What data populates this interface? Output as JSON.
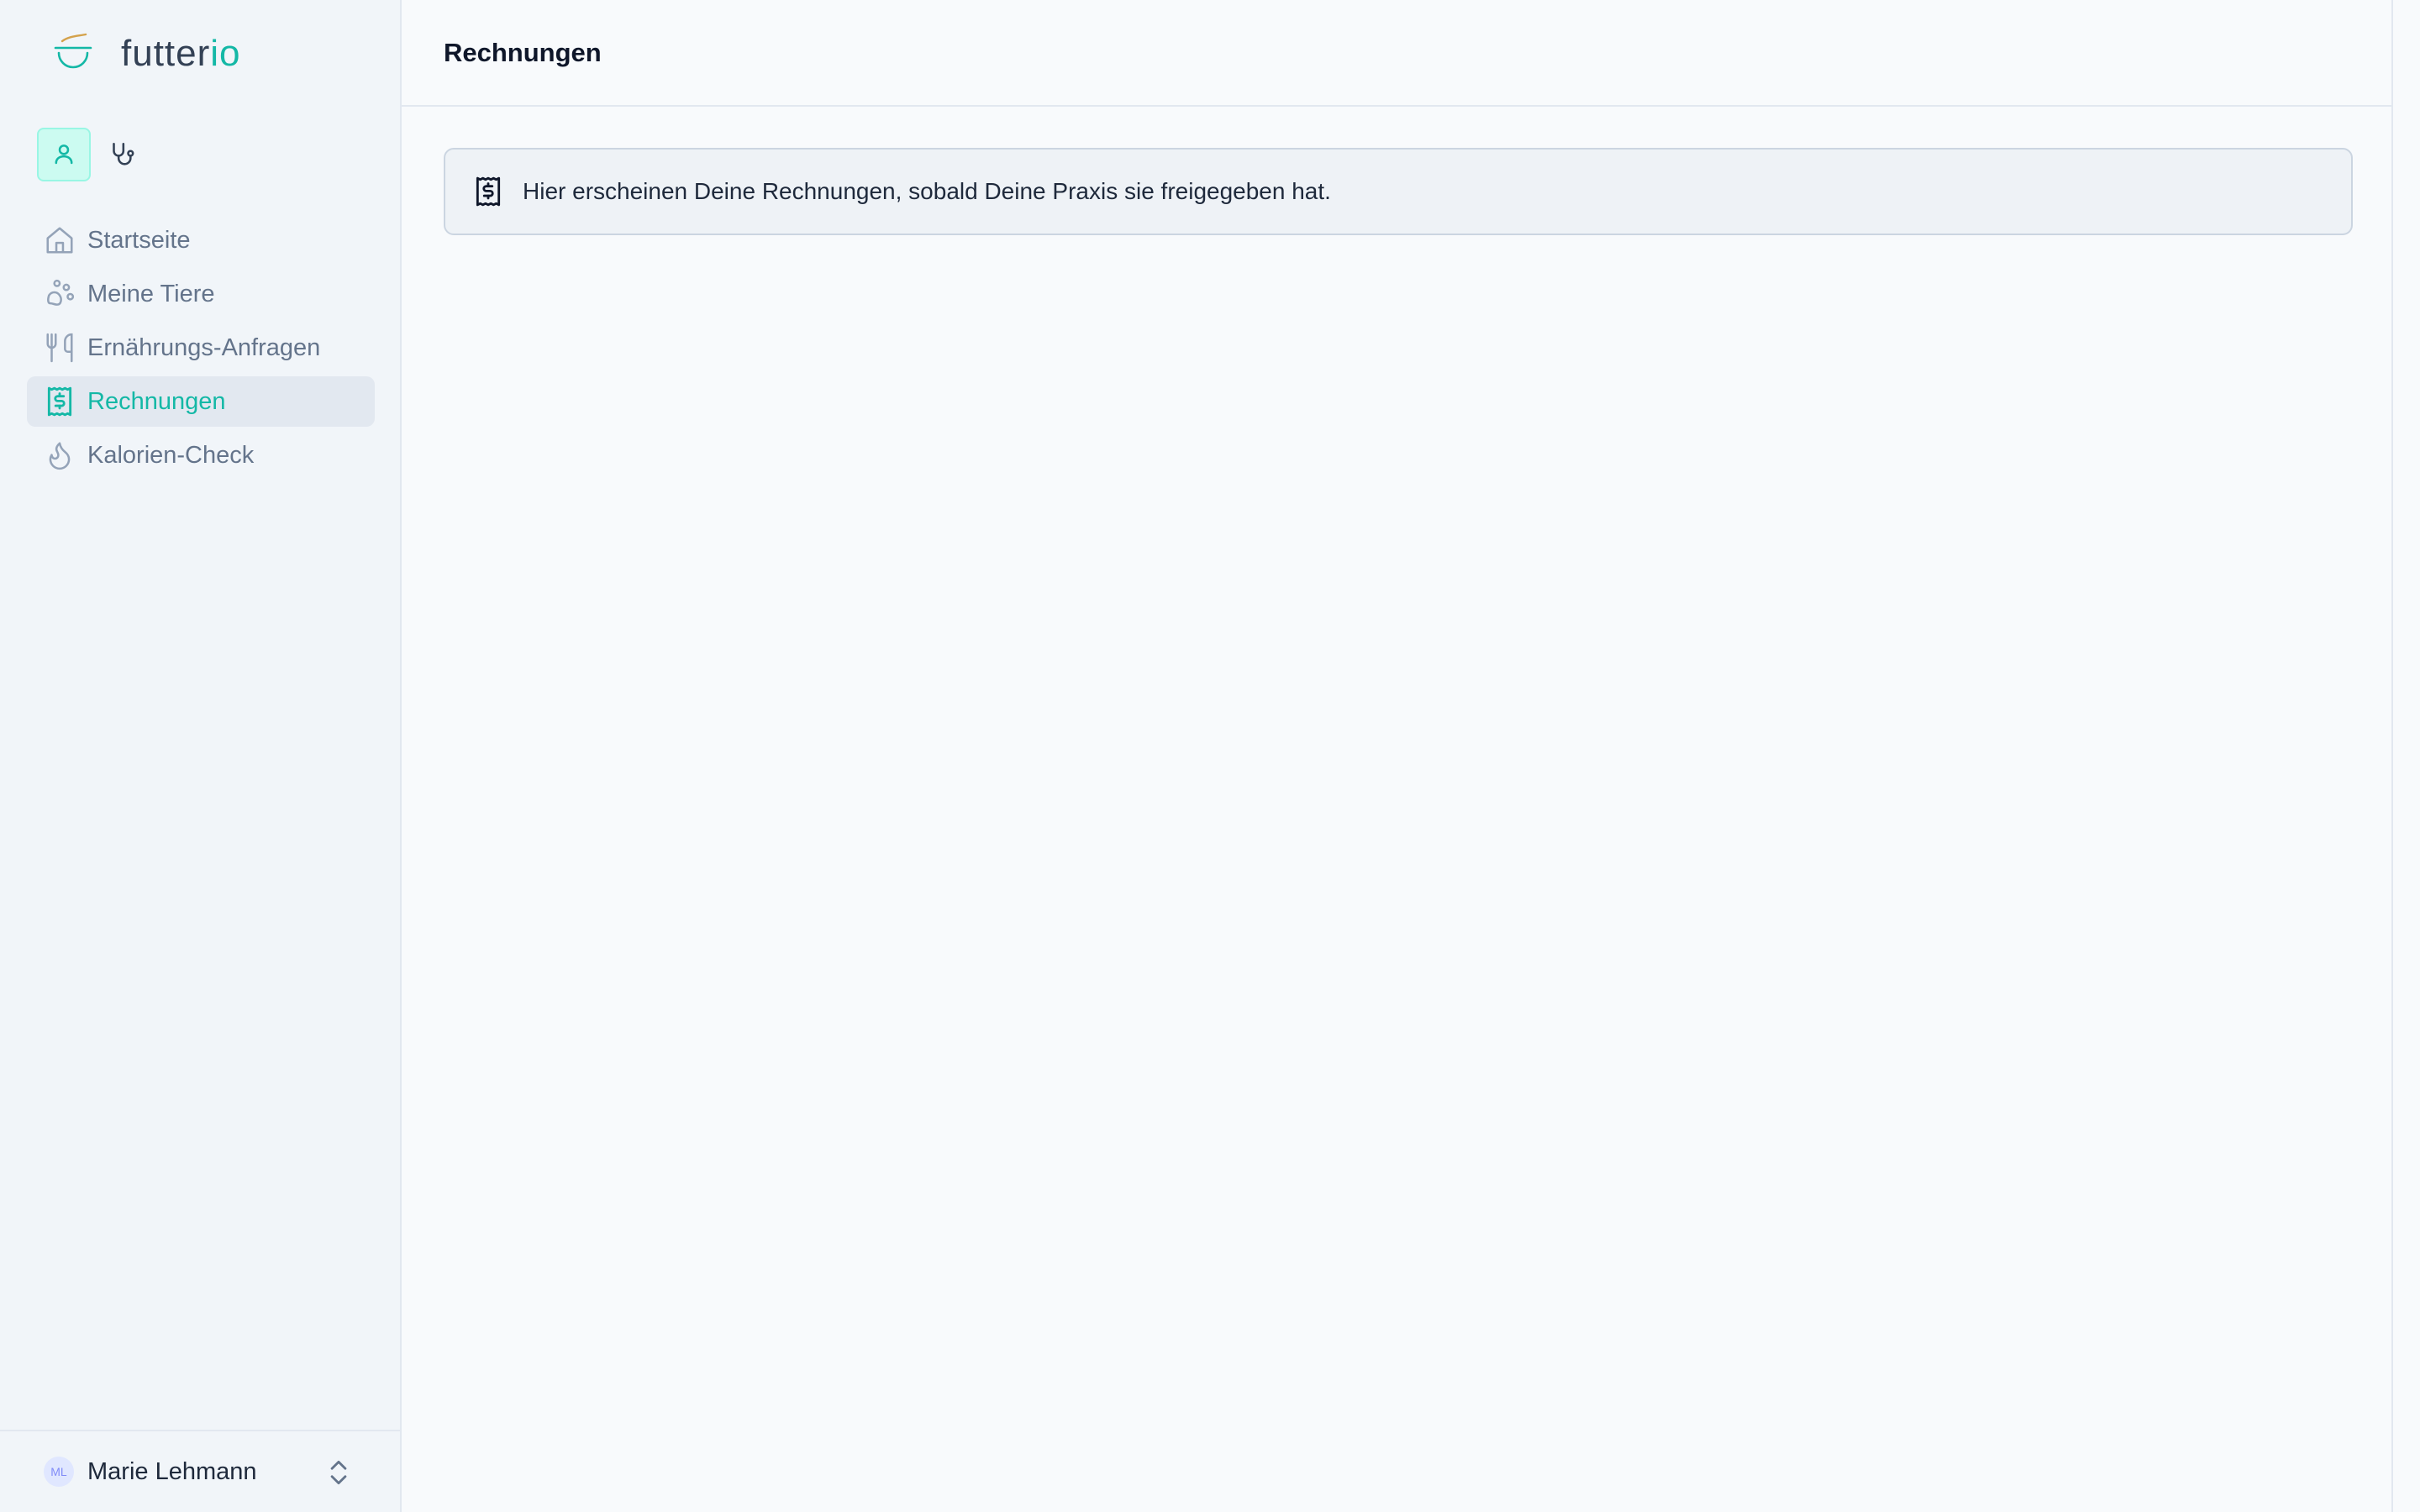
{
  "brand": {
    "name_main": "futter",
    "name_accent": "io",
    "accent_color": "#14b8a6"
  },
  "role_switch": {
    "owner_icon": "user-icon",
    "vet_icon": "stethoscope-icon"
  },
  "sidebar": {
    "items": [
      {
        "label": "Startseite",
        "icon": "home-icon"
      },
      {
        "label": "Meine Tiere",
        "icon": "paw-icon"
      },
      {
        "label": "Ernährungs-Anfragen",
        "icon": "utensils-icon"
      },
      {
        "label": "Rechnungen",
        "icon": "receipt-icon",
        "active": true
      },
      {
        "label": "Kalorien-Check",
        "icon": "flame-icon"
      }
    ]
  },
  "user": {
    "initials": "ML",
    "name": "Marie Lehmann"
  },
  "header": {
    "title": "Rechnungen"
  },
  "notice": {
    "text": "Hier erscheinen Deine Rechnungen, sobald Deine Praxis sie freigegeben hat."
  }
}
